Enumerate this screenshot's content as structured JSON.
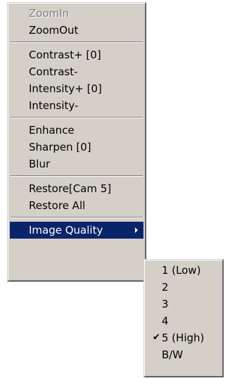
{
  "main_menu": {
    "items": [
      {
        "label": "ZoomIn"
      },
      {
        "label": "ZoomOut"
      },
      {
        "label": "Contrast+ [0]"
      },
      {
        "label": "Contrast-"
      },
      {
        "label": "Intensity+ [0]"
      },
      {
        "label": "Intensity-"
      },
      {
        "label": "Enhance"
      },
      {
        "label": "Sharpen [0]"
      },
      {
        "label": "Blur"
      },
      {
        "label": "Restore[Cam 5]"
      },
      {
        "label": "Restore All"
      },
      {
        "label": "Image Quality"
      }
    ],
    "disabled_item": "ZoomIn",
    "highlighted_item": "Image Quality",
    "highlight_color": "#0a246a",
    "menu_background": "#d4d0c8"
  },
  "sub_menu": {
    "items": [
      {
        "label": "1 (Low)"
      },
      {
        "label": "2"
      },
      {
        "label": "3"
      },
      {
        "label": "4"
      },
      {
        "label": "5 (High)"
      },
      {
        "label": "B/W"
      }
    ],
    "checked_item": "5 (High)",
    "check_glyph": "✔"
  }
}
